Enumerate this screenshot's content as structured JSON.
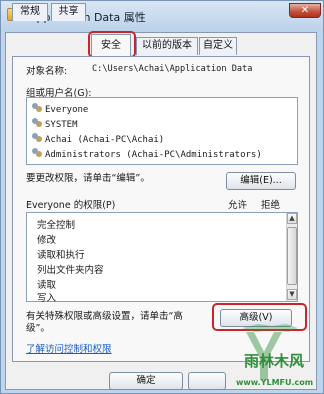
{
  "window": {
    "title": "Application Data 属性",
    "close_glyph": "✕"
  },
  "tabs": [
    {
      "label": "常规"
    },
    {
      "label": "共享"
    },
    {
      "label": "安全"
    },
    {
      "label": "以前的版本"
    },
    {
      "label": "自定义"
    }
  ],
  "security": {
    "object_label": "对象名称:",
    "object_path": "C:\\Users\\Achai\\Application Data",
    "groups_label": "组或用户名(G):",
    "users": [
      {
        "name": "Everyone"
      },
      {
        "name": "SYSTEM"
      },
      {
        "name": "Achai (Achai-PC\\Achai)"
      },
      {
        "name": "Administrators (Achai-PC\\Administrators)"
      }
    ],
    "change_perm_text": "要更改权限，请单击“编辑”。",
    "edit_button": "编辑(E)...",
    "perm_header": "Everyone 的权限(P)",
    "allow_header": "允许",
    "deny_header": "拒绝",
    "permissions": [
      {
        "name": "完全控制"
      },
      {
        "name": "修改"
      },
      {
        "name": "读取和执行"
      },
      {
        "name": "列出文件夹内容"
      },
      {
        "name": "读取"
      },
      {
        "name": "写入"
      }
    ],
    "special_text_line1": "有关特殊权限或高级设置，请单击“高",
    "special_text_line2": "级”。",
    "advanced_button": "高级(V)",
    "learn_link": "了解访问控制和权限"
  },
  "footer": {
    "ok_button": "确定"
  },
  "watermark": {
    "brand": "雨林木风",
    "url": "www.YLMFU.com"
  },
  "colors": {
    "highlight_ring": "#c8262a",
    "link": "#1a5fc0",
    "watermark_green": "#2f8f3a"
  }
}
